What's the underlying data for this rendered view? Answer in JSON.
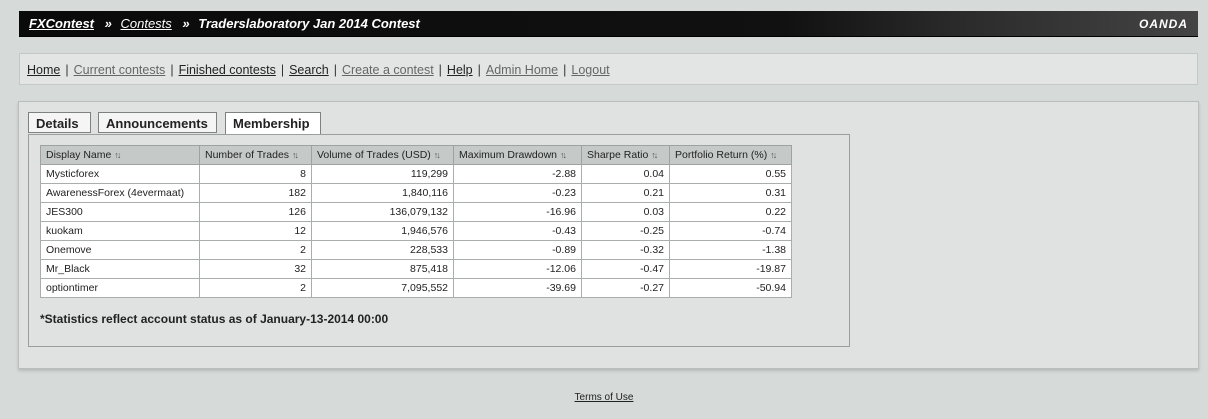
{
  "header": {
    "crumb_home": "FXContest",
    "crumb_sep1": "»",
    "crumb_contests": "Contests",
    "crumb_sep2": "»",
    "crumb_current": "Traderslaboratory Jan 2014 Contest",
    "brand": "OANDA"
  },
  "nav": {
    "items": [
      {
        "label": "Home"
      },
      {
        "label": "Current contests"
      },
      {
        "label": "Finished contests"
      },
      {
        "label": "Search"
      },
      {
        "label": "Create a contest"
      },
      {
        "label": "Help"
      },
      {
        "label": "Admin Home"
      },
      {
        "label": "Logout"
      }
    ],
    "separator": "|"
  },
  "tabs": [
    {
      "label": "Details"
    },
    {
      "label": "Announcements"
    },
    {
      "label": "Membership"
    }
  ],
  "table": {
    "sort_glyph": "↑↓",
    "columns": [
      "Display Name",
      "Number of Trades",
      "Volume of Trades (USD)",
      "Maximum Drawdown",
      "Sharpe Ratio",
      "Portfolio Return (%)"
    ],
    "rows": [
      [
        "Mysticforex",
        "8",
        "119,299",
        "-2.88",
        "0.04",
        "0.55"
      ],
      [
        "AwarenessForex (4evermaat)",
        "182",
        "1,840,116",
        "-0.23",
        "0.21",
        "0.31"
      ],
      [
        "JES300",
        "126",
        "136,079,132",
        "-16.96",
        "0.03",
        "0.22"
      ],
      [
        "kuokam",
        "12",
        "1,946,576",
        "-0.43",
        "-0.25",
        "-0.74"
      ],
      [
        "Onemove",
        "2",
        "228,533",
        "-0.89",
        "-0.32",
        "-1.38"
      ],
      [
        "Mr_Black",
        "32",
        "875,418",
        "-12.06",
        "-0.47",
        "-19.87"
      ],
      [
        "optiontimer",
        "2",
        "7,095,552",
        "-39.69",
        "-0.27",
        "-50.94"
      ]
    ]
  },
  "note": "*Statistics reflect account status as of January-13-2014 00:00",
  "footer": {
    "terms": "Terms of Use"
  }
}
